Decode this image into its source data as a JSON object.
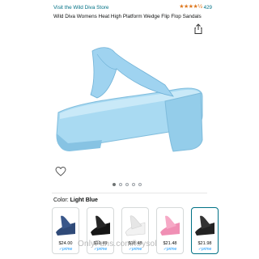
{
  "header": {
    "store_link": "Visit the Wild Diva Store",
    "stars": "★★★★½",
    "rating_count": "429",
    "title": "Wild Diva Womens Heat High Platform Wedge Flip Flop Sandals"
  },
  "gallery": {
    "icons": {
      "share": "share-icon",
      "wishlist": "heart-icon"
    },
    "dot_count": 5,
    "active_dot": 0
  },
  "color": {
    "label": "Color:",
    "selected": "Light Blue"
  },
  "swatches": [
    {
      "name": "Navy",
      "color": "#2f4a78",
      "price": "$24.00",
      "prime": "✓prime"
    },
    {
      "name": "Black",
      "color": "#151515",
      "price": "$19.49",
      "prime": "✓prime"
    },
    {
      "name": "White",
      "color": "#f2f2f2",
      "price": "$18.48",
      "prime": "✓prime"
    },
    {
      "name": "Pink",
      "color": "#f08fb4",
      "price": "$21.48",
      "prime": "✓prime"
    },
    {
      "name": "Black Patent",
      "color": "#222222",
      "price": "$21.98",
      "prime": "✓prime"
    }
  ],
  "watermark": "OnlyFans.com/hrysol",
  "colors": {
    "link": "#007185",
    "star": "#de7921",
    "sandal": "#9fd3f0",
    "prime": "#1399ff"
  }
}
